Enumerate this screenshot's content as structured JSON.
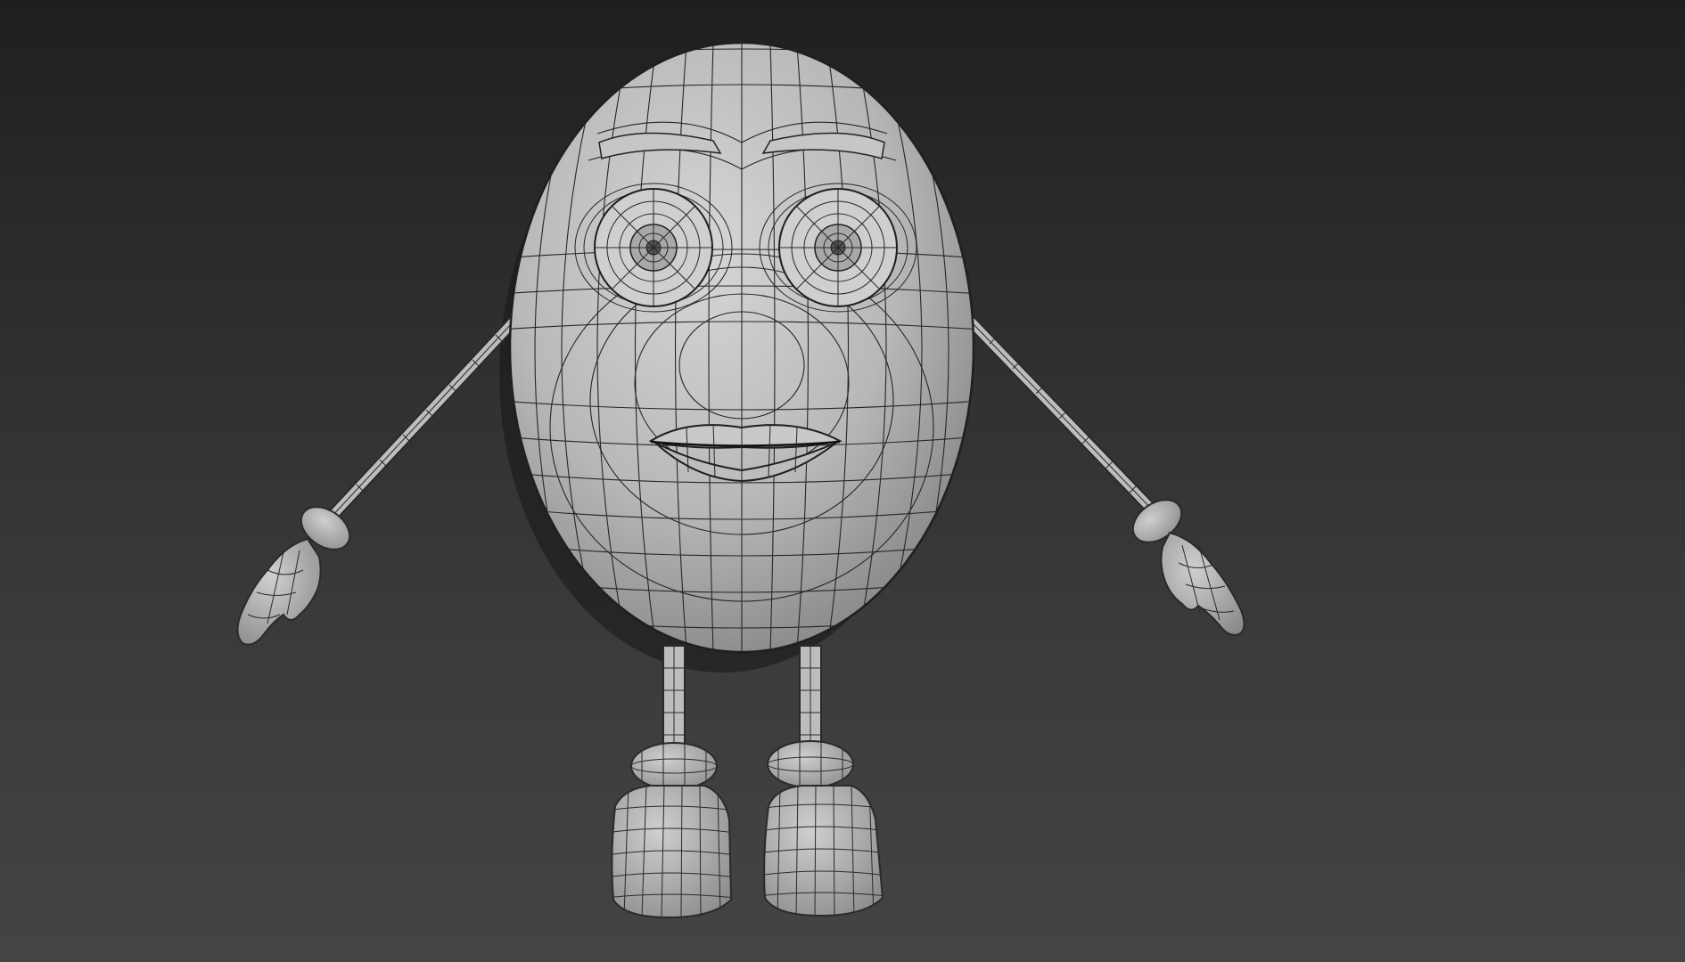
{
  "viewport": {
    "background_top": "#1f1f1f",
    "background_bottom": "#444444"
  },
  "model": {
    "surface_color": "#bdbdbd",
    "wire_color": "#2a2a2a",
    "shadow_color": "#0e0e0e"
  }
}
